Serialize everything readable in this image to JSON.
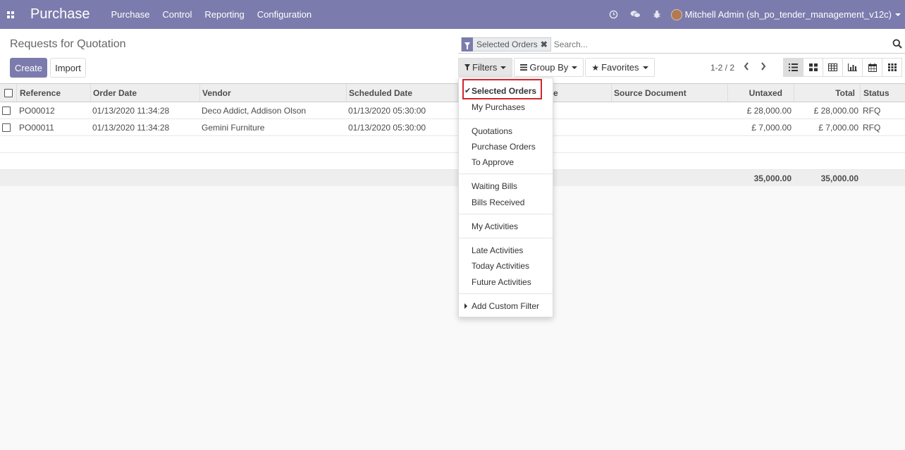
{
  "navbar": {
    "app_name": "Purchase",
    "menus": [
      "Purchase",
      "Control",
      "Reporting",
      "Configuration"
    ],
    "icons": [
      "clock-icon",
      "chat-icon",
      "bug-icon"
    ],
    "user": "Mitchell Admin (sh_po_tender_management_v12c)"
  },
  "control": {
    "title": "Requests for Quotation",
    "create_label": "Create",
    "import_label": "Import",
    "facet_label": "Selected Orders",
    "search_placeholder": "Search...",
    "filters_label": "Filters",
    "groupby_label": "Group By",
    "favorites_label": "Favorites",
    "pager": "1-2 / 2",
    "views": [
      "list-view-icon",
      "kanban-view-icon",
      "pivot-view-icon",
      "graph-view-icon",
      "calendar-view-icon",
      "grid-view-icon"
    ]
  },
  "table": {
    "headers": {
      "reference": "Reference",
      "order_date": "Order Date",
      "vendor": "Vendor",
      "scheduled_date": "Scheduled Date",
      "hidden_col": "e",
      "source_document": "Source Document",
      "untaxed": "Untaxed",
      "total": "Total",
      "status": "Status"
    },
    "rows": [
      {
        "reference": "PO00012",
        "order_date": "01/13/2020 11:34:28",
        "vendor": "Deco Addict, Addison Olson",
        "scheduled_date": "01/13/2020 05:30:00",
        "untaxed": "£ 28,000.00",
        "total": "£ 28,000.00",
        "status": "RFQ"
      },
      {
        "reference": "PO00011",
        "order_date": "01/13/2020 11:34:28",
        "vendor": "Gemini Furniture",
        "scheduled_date": "01/13/2020 05:30:00",
        "untaxed": "£ 7,000.00",
        "total": "£ 7,000.00",
        "status": "RFQ"
      }
    ],
    "footer": {
      "untaxed": "35,000.00",
      "total": "35,000.00"
    }
  },
  "filters_menu": {
    "selected": "Selected Orders",
    "my_purchases": "My Purchases",
    "quotations": "Quotations",
    "purchase_orders": "Purchase Orders",
    "to_approve": "To Approve",
    "waiting_bills": "Waiting Bills",
    "bills_received": "Bills Received",
    "my_activities": "My Activities",
    "late_activities": "Late Activities",
    "today_activities": "Today Activities",
    "future_activities": "Future Activities",
    "add_custom_filter": "Add Custom Filter"
  },
  "colors": {
    "brand": "#7c7bad",
    "highlight": "#d0262c"
  }
}
